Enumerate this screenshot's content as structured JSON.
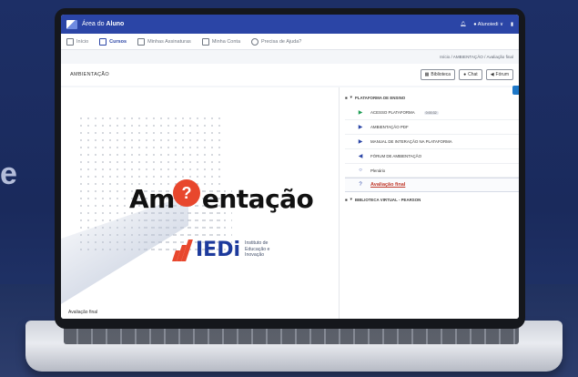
{
  "background_text": "e",
  "app": {
    "title_prefix": "Área do",
    "title_bold": "Aluno",
    "user_label": "Alunoiedi ∨"
  },
  "nav": {
    "tabs": [
      {
        "label": "Início",
        "icon": "home-icon"
      },
      {
        "label": "Cursos",
        "icon": "book-icon"
      },
      {
        "label": "Minhas Assinaturas",
        "icon": "chart-icon"
      },
      {
        "label": "Minha Conta",
        "icon": "user-icon"
      },
      {
        "label": "Precisa de Ajuda?",
        "icon": "help-icon"
      }
    ]
  },
  "breadcrumb": "Início / AMBIENTAÇÃO / Avaliação final",
  "page_title": "AMBIENTAÇÃO",
  "buttons": {
    "library": "Biblioteca",
    "chat": "Chat",
    "forum": "Fórum"
  },
  "video": {
    "headline_start": "Am",
    "headline_question": "?",
    "headline_end": "entação",
    "logo_word": "IEDi",
    "logo_sub_1": "Instituto de",
    "logo_sub_2": "Educação e",
    "logo_sub_3": "Inovação",
    "caption": "Avaliação final"
  },
  "sidebar": {
    "section_1": "PLATAFORMA DE ENSINO",
    "items": [
      {
        "icon": "play-icon",
        "label": "ACESSO PLATAFORMA",
        "badge": "0:00:32"
      },
      {
        "icon": "play-icon",
        "label": "AMBIENTAÇÃO PDF"
      },
      {
        "icon": "play-icon",
        "label": "MANUAL DE INTERAÇÃO NA PLATAFORMA"
      },
      {
        "icon": "megaphone-icon",
        "label": "FÓRUM DE AMBIENTAÇÃO"
      },
      {
        "icon": "chat-icon",
        "label": "Plenário"
      },
      {
        "icon": "question-icon",
        "label": "Avaliação final"
      }
    ],
    "section_2": "BIBLIOTECA VIRTUAL - PEARSON"
  },
  "colors": {
    "brand": "#2b45a6",
    "accent": "#e8472d"
  }
}
